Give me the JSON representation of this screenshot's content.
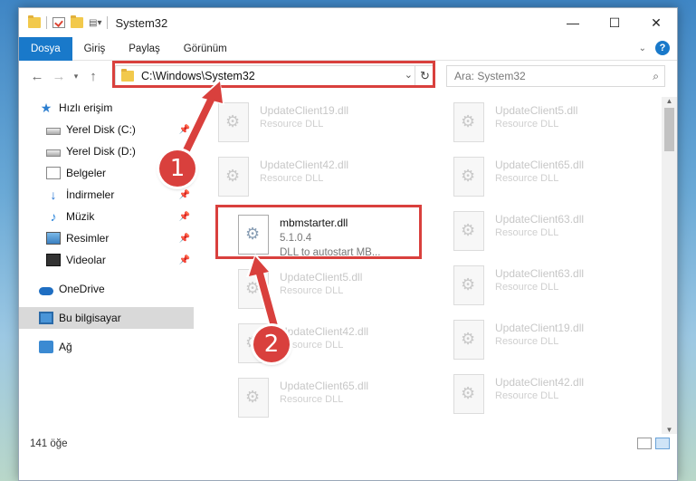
{
  "window": {
    "title": "System32"
  },
  "ribbon": {
    "tabs": [
      "Dosya",
      "Giriş",
      "Paylaş",
      "Görünüm"
    ]
  },
  "address": {
    "path": "C:\\Windows\\System32",
    "search_placeholder": "Ara: System32"
  },
  "nav": {
    "quick_access": "Hızlı erişim",
    "items": [
      "Yerel Disk (C:)",
      "Yerel Disk (D:)",
      "Belgeler",
      "İndirmeler",
      "Müzik",
      "Resimler",
      "Videolar"
    ],
    "onedrive": "OneDrive",
    "this_pc": "Bu bilgisayar",
    "network": "Ağ"
  },
  "files": {
    "left": [
      {
        "name": "UpdateClient19.dll",
        "desc": "Resource DLL"
      },
      {
        "name": "UpdateClient42.dll",
        "desc": "Resource DLL"
      },
      {
        "name": "UpdateClient5.dll",
        "desc": "Resource DLL"
      },
      {
        "name": "UpdateClient42.dll",
        "desc": "Resource DLL"
      },
      {
        "name": "UpdateClient65.dll",
        "desc": "Resource DLL"
      }
    ],
    "right": [
      {
        "name": "UpdateClient5.dll",
        "desc": "Resource DLL"
      },
      {
        "name": "UpdateClient65.dll",
        "desc": "Resource DLL"
      },
      {
        "name": "UpdateClient63.dll",
        "desc": "Resource DLL"
      },
      {
        "name": "UpdateClient63.dll",
        "desc": "Resource DLL"
      },
      {
        "name": "UpdateClient19.dll",
        "desc": "Resource DLL"
      },
      {
        "name": "UpdateClient42.dll",
        "desc": "Resource DLL"
      }
    ],
    "highlighted": {
      "name": "mbmstarter.dll",
      "version": "5.1.0.4",
      "desc": "DLL to autostart MB..."
    }
  },
  "status": {
    "count": "141 öğe"
  },
  "annotations": {
    "step1": "1",
    "step2": "2"
  },
  "colors": {
    "accent": "#1979ca",
    "annotation": "#d9403d"
  }
}
